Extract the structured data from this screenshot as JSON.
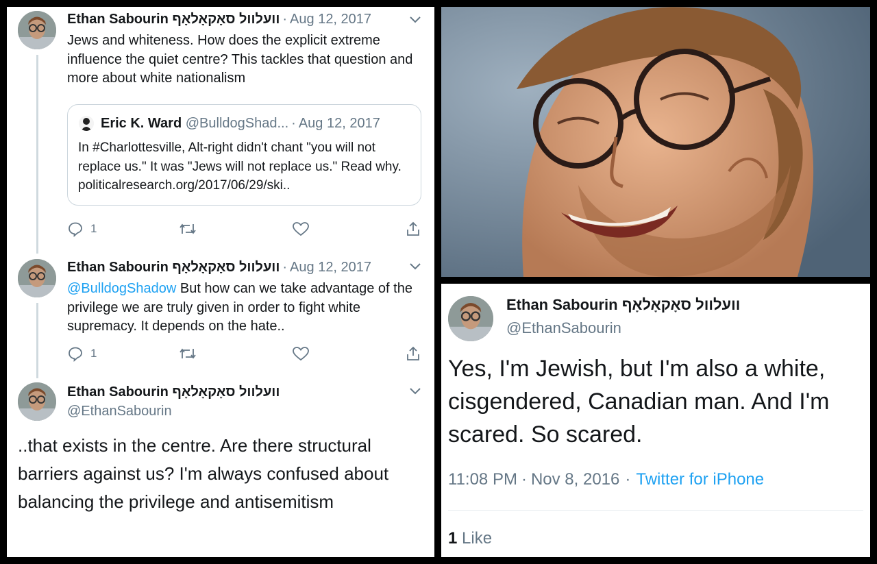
{
  "tweets": [
    {
      "name": "Ethan Sabourin וועלוול סאָקאָלאָף",
      "date": "Aug 12, 2017",
      "text": "Jews and whiteness. How does the explicit extreme influence the quiet centre? This tackles that question and more about white nationalism",
      "quoted": {
        "name": "Eric K. Ward",
        "handle": "@BulldogShad...",
        "date": "Aug 12, 2017",
        "text": "In #Charlottesville, Alt-right didn't chant \"you will not replace us.\" It was \"Jews will not replace us.\" Read why. politicalresearch.org/2017/06/29/ski.."
      },
      "reply_count": "1"
    },
    {
      "name": "Ethan Sabourin וועלוול סאָקאָלאָף",
      "date": "Aug 12, 2017",
      "mention": "@BulldogShadow",
      "text": " But how can we take advantage of the privilege we are truly given in order to fight white supremacy. It depends on the hate..",
      "reply_count": "1"
    },
    {
      "name": "Ethan Sabourin וועלוול סאָקאָלאָף",
      "handle": "@EthanSabourin",
      "text": "..that exists in the centre. Are there structural barriers against us? I'm always confused about balancing the privilege and antisemitism"
    }
  ],
  "profile_tweet": {
    "name": "Ethan Sabourin וועלוול סאָקאָלאָף",
    "handle": "@EthanSabourin",
    "text": "Yes, I'm Jewish, but I'm also a white, cisgendered, Canadian man. And I'm scared. So scared.",
    "time": "11:08 PM",
    "date": "Nov 8, 2016",
    "source": "Twitter for iPhone",
    "like_count": "1",
    "like_label": "Like"
  },
  "separator_dot": "·",
  "colors": {
    "accent": "#1da1f2",
    "muted": "#657786",
    "border": "#ccd6dd",
    "background": "#000000"
  },
  "icons": [
    "reply-icon",
    "retweet-icon",
    "like-icon",
    "share-icon",
    "chevron-down-icon",
    "avatar",
    "photo"
  ]
}
